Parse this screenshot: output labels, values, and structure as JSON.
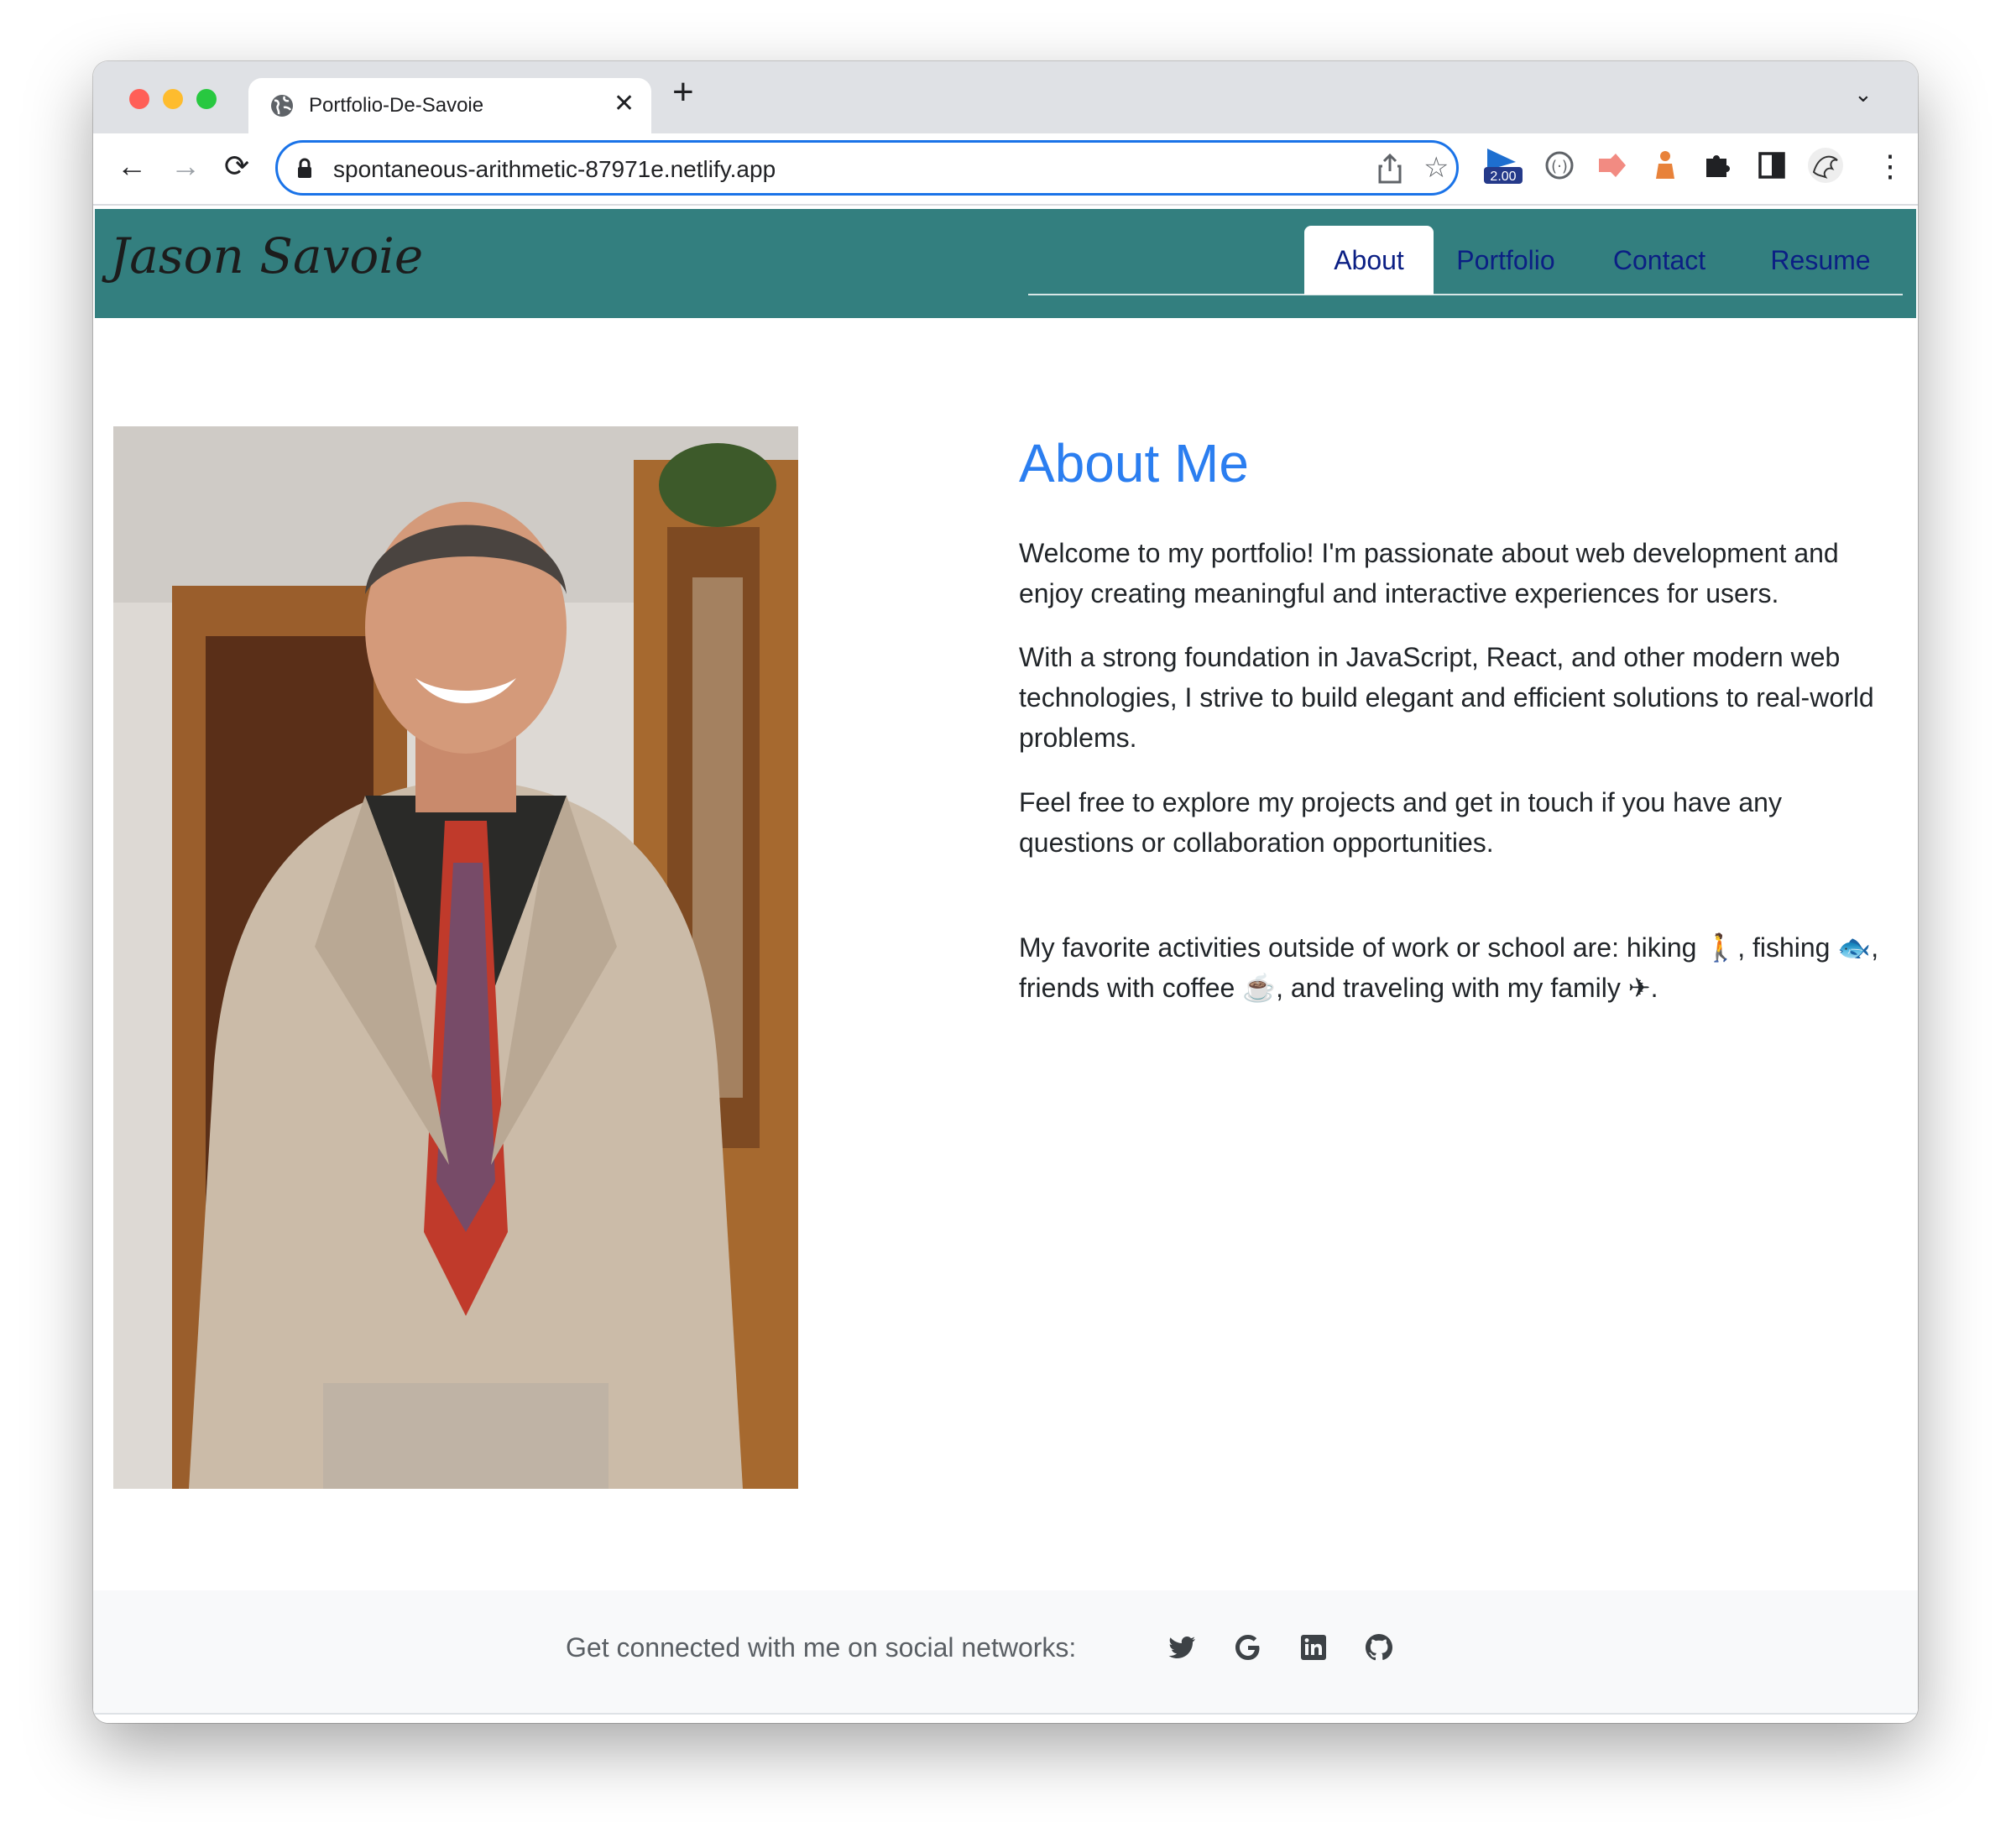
{
  "browser": {
    "tab_title": "Portfolio-De-Savoie",
    "tab_close": "✕",
    "new_tab": "+",
    "tab_menu": "⌄",
    "url": "spontaneous-arithmetic-87971e.netlify.app",
    "back": "←",
    "forward": "→",
    "reload": "⟳",
    "star": "☆",
    "extension_badge": "2.00",
    "menu": "⋮"
  },
  "site": {
    "brand": "Jason Savoie",
    "nav": [
      "About",
      "Portfolio",
      "Contact",
      "Resume"
    ],
    "active_nav": "About"
  },
  "about": {
    "heading": "About Me",
    "p1": "Welcome to my portfolio! I'm passionate about web development and enjoy creating meaningful and interactive experiences for users.",
    "p2": "With a strong foundation in JavaScript, React, and other modern web technologies, I strive to build elegant and efficient solutions to real-world problems.",
    "p3": "Feel free to explore my projects and get in touch if you have any questions or collaboration opportunities.",
    "p4": "My favorite activities outside of work or school are: hiking 🚶, fishing 🐟, friends with coffee ☕, and traveling with my family ✈."
  },
  "footer": {
    "text": "Get connected with me on social networks:",
    "icons": [
      "twitter-icon",
      "google-icon",
      "linkedin-icon",
      "github-icon"
    ]
  },
  "colors": {
    "header_bg": "#337f7f",
    "heading": "#2b7ef0",
    "nav_link": "#0b1f84",
    "omnibox_border": "#1a73e8"
  }
}
